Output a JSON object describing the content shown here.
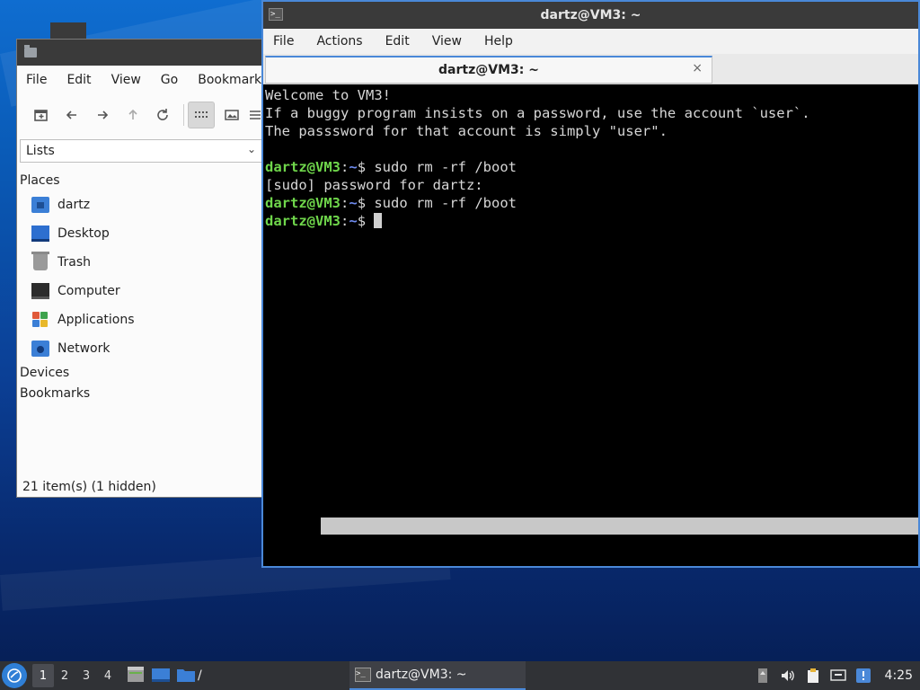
{
  "file_manager": {
    "menu": [
      "File",
      "Edit",
      "View",
      "Go",
      "Bookmarks"
    ],
    "view_select": "Lists",
    "sections": {
      "places": "Places",
      "devices": "Devices",
      "bookmarks": "Bookmarks"
    },
    "places": [
      {
        "label": "dartz",
        "icon": "home-folder-icon"
      },
      {
        "label": "Desktop",
        "icon": "desktop-icon"
      },
      {
        "label": "Trash",
        "icon": "trash-icon"
      },
      {
        "label": "Computer",
        "icon": "computer-icon"
      },
      {
        "label": "Applications",
        "icon": "applications-icon"
      },
      {
        "label": "Network",
        "icon": "network-icon"
      }
    ],
    "status": "21 item(s) (1 hidden)"
  },
  "terminal": {
    "window_title": "dartz@VM3: ~",
    "menu": [
      "File",
      "Actions",
      "Edit",
      "View",
      "Help"
    ],
    "tab_title": "dartz@VM3: ~",
    "tab_close": "×",
    "lines": {
      "l1": "Welcome to VM3!",
      "l2": "If a buggy program insists on a password, use the account `user`.",
      "l3": "The passsword for that account is simply \"user\".",
      "l5_user": "dartz@VM3",
      "l5_sep": ":",
      "l5_path": "~",
      "l5_cmd": "$ sudo rm -rf /boot",
      "l6": "[sudo] password for dartz:",
      "l7_user": "dartz@VM3",
      "l7_sep": ":",
      "l7_path": "~",
      "l7_cmd": "$ sudo rm -rf /boot",
      "l8_user": "dartz@VM3",
      "l8_sep": ":",
      "l8_path": "~",
      "l8_cmd": "$ "
    }
  },
  "taskbar": {
    "workspaces": [
      "1",
      "2",
      "3",
      "4"
    ],
    "path_launcher": "/",
    "task_label": "dartz@VM3: ~",
    "clock": "4:25"
  },
  "colors": {
    "accent": "#4a88d8",
    "prompt_user": "#6fd64b",
    "prompt_path": "#6f8cf0",
    "taskbar": "#303236"
  }
}
